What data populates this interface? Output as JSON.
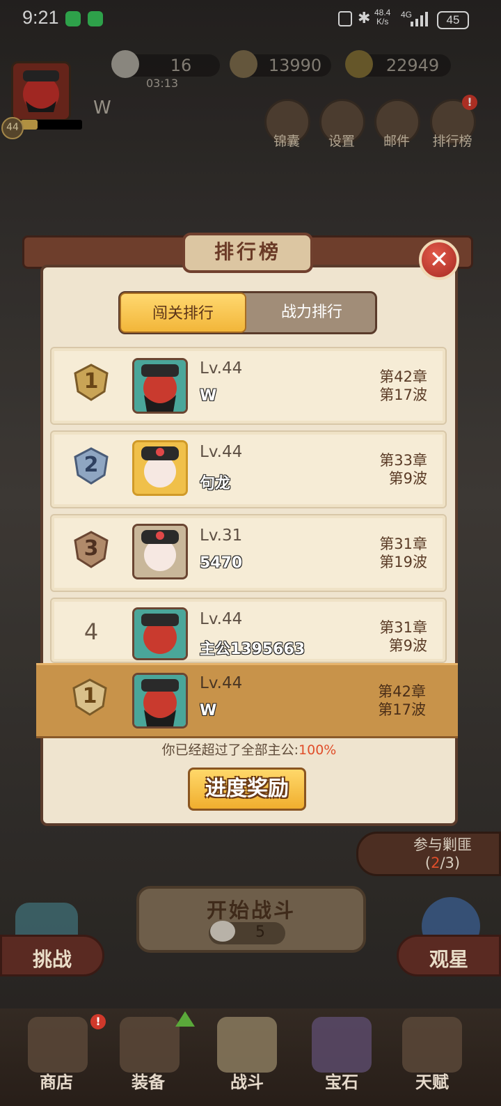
{
  "status_bar": {
    "time": "9:21",
    "net_speed_value": "48.4",
    "net_speed_unit": "K/s",
    "network_type": "4G",
    "battery": "45"
  },
  "hud": {
    "player_level": "44",
    "player_name": "W",
    "stamina": "16",
    "stamina_timer": "03:13",
    "coins": "13990",
    "gems": "22949",
    "top_buttons": [
      {
        "label": "锦囊",
        "icon": "pouch-icon"
      },
      {
        "label": "设置",
        "icon": "gear-icon"
      },
      {
        "label": "邮件",
        "icon": "mail-icon"
      },
      {
        "label": "排行榜",
        "icon": "ranking-icon",
        "notification": "!"
      }
    ]
  },
  "dialog": {
    "title": "排行榜",
    "close_symbol": "✕",
    "tabs": [
      {
        "label": "闯关排行",
        "active": true
      },
      {
        "label": "战力排行",
        "active": false
      }
    ],
    "rows": [
      {
        "rank": "1",
        "level": "Lv.44",
        "name": "W",
        "chapter": "第42章",
        "wave": "第17波",
        "hero": "red-face"
      },
      {
        "rank": "2",
        "level": "Lv.44",
        "name": "句龙",
        "chapter": "第33章",
        "wave": "第9波",
        "hero": "white-face-gold"
      },
      {
        "rank": "3",
        "level": "Lv.31",
        "name": "5470",
        "chapter": "第31章",
        "wave": "第19波",
        "hero": "white-face"
      },
      {
        "rank": "4",
        "level": "Lv.44",
        "name": "主公1395663",
        "chapter": "第31章",
        "wave": "第9波",
        "hero": "red-face"
      }
    ],
    "self_row": {
      "rank": "1",
      "level": "Lv.44",
      "name": "W",
      "chapter": "第42章",
      "wave": "第17波"
    },
    "surpass_text": "你已经超过了全部主公:",
    "surpass_percent": "100%",
    "reward_button": "进度奖励"
  },
  "lower_hud": {
    "bandit_label": "参与剿匪",
    "bandit_count_open": "(",
    "bandit_count_current": "2",
    "bandit_count_rest": "/3)",
    "start_battle": "开始战斗",
    "battle_cost": "5",
    "challenge": "挑战",
    "stargaze": "观星"
  },
  "nav": [
    {
      "label": "商店",
      "icon": "shop-icon",
      "notification": "!"
    },
    {
      "label": "装备",
      "icon": "equipment-icon"
    },
    {
      "label": "战斗",
      "icon": "battle-icon"
    },
    {
      "label": "宝石",
      "icon": "gem-chest-icon"
    },
    {
      "label": "天赋",
      "icon": "talent-book-icon"
    }
  ],
  "colors": {
    "active_tab": "#f2b63a",
    "self_row": "#c8934a",
    "percent_accent": "#e04e2a",
    "close_button": "#c23a2c"
  }
}
